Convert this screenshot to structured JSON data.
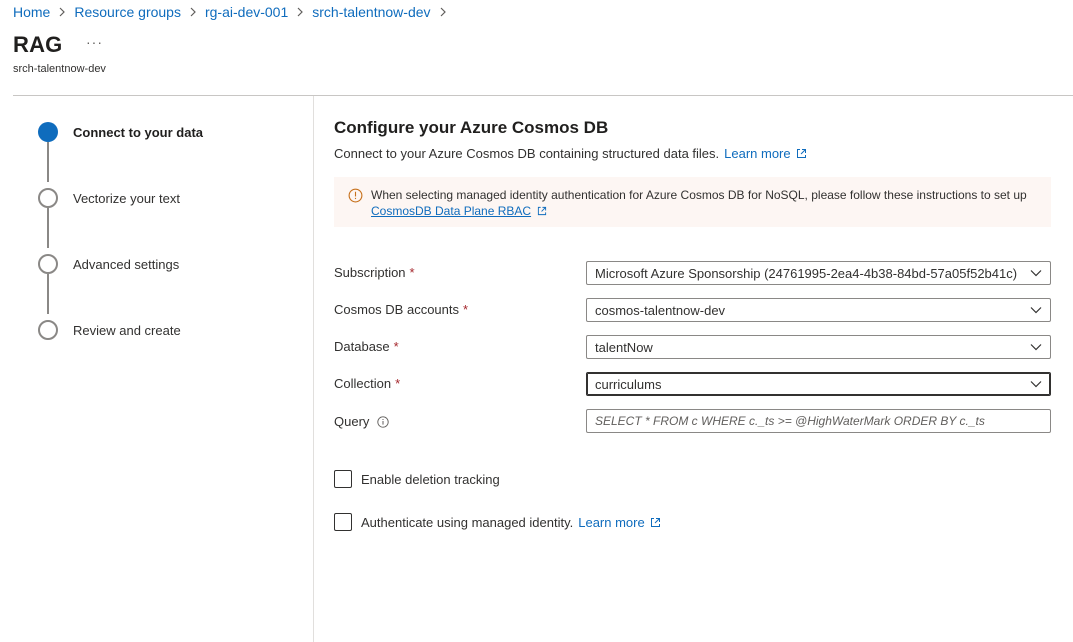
{
  "breadcrumb": {
    "items": [
      {
        "label": "Home"
      },
      {
        "label": "Resource groups"
      },
      {
        "label": "rg-ai-dev-001"
      },
      {
        "label": "srch-talentnow-dev"
      }
    ]
  },
  "header": {
    "title": "RAG",
    "more_label": "···",
    "subtitle": "srch-talentnow-dev"
  },
  "steps": [
    {
      "label": "Connect to your data",
      "active": true
    },
    {
      "label": "Vectorize your text",
      "active": false
    },
    {
      "label": "Advanced settings",
      "active": false
    },
    {
      "label": "Review and create",
      "active": false
    }
  ],
  "main": {
    "title": "Configure your Azure Cosmos DB",
    "description": "Connect to your Azure Cosmos DB containing structured data files.",
    "learn_more": "Learn more",
    "banner": {
      "text": "When selecting managed identity authentication for Azure Cosmos DB for NoSQL, please follow these instructions to set up",
      "link": "CosmosDB Data Plane RBAC"
    },
    "fields": {
      "subscription": {
        "label": "Subscription",
        "value": "Microsoft Azure Sponsorship (24761995-2ea4-4b38-84bd-57a05f52b41c)"
      },
      "cosmos_accounts": {
        "label": "Cosmos DB accounts",
        "value": "cosmos-talentnow-dev"
      },
      "database": {
        "label": "Database",
        "value": "talentNow"
      },
      "collection": {
        "label": "Collection",
        "value": "curriculums"
      },
      "query": {
        "label": "Query",
        "placeholder": "SELECT * FROM c WHERE c._ts >= @HighWaterMark ORDER BY c._ts"
      }
    },
    "required_mark": "*",
    "checkboxes": {
      "deletion_tracking": {
        "label": "Enable deletion tracking",
        "checked": false
      },
      "managed_identity": {
        "label": "Authenticate using managed identity.",
        "link": "Learn more",
        "checked": false
      }
    }
  },
  "colors": {
    "accent": "#0f6cbd",
    "required": "#a4262c",
    "banner_bg": "#fdf6f3",
    "warning_icon": "#c7711c"
  }
}
